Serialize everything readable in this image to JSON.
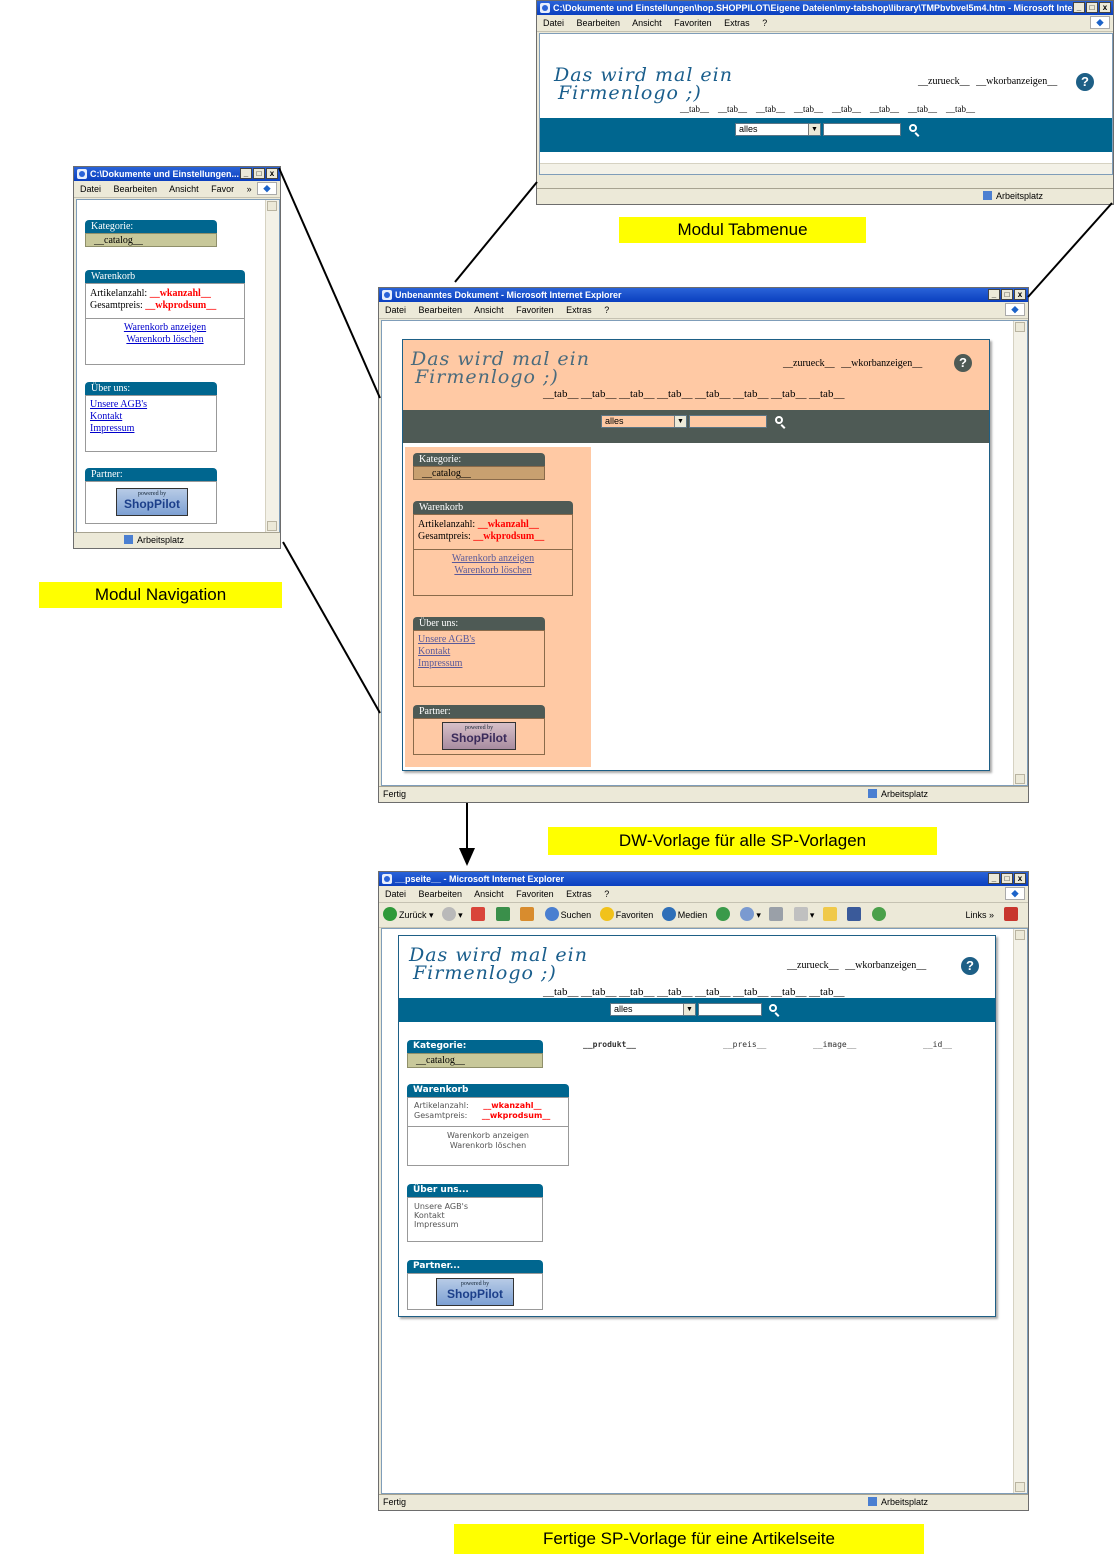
{
  "captions": {
    "tabmenue": "Modul Tabmenue",
    "navigation": "Modul Navigation",
    "dw_vorlage": "DW-Vorlage für alle SP-Vorlagen",
    "fertige": "Fertige SP-Vorlage für eine Artikelseite"
  },
  "menu": {
    "datei": "Datei",
    "bearbeiten": "Bearbeiten",
    "ansicht": "Ansicht",
    "favoriten": "Favoriten",
    "favor_short": "Favor",
    "extras": "Extras",
    "help": "?",
    "more": "»"
  },
  "window_tabmenue": {
    "title": "C:\\Dokumente und Einstellungen\\hop.SHOPPILOT\\Eigene Dateien\\my-tabshop\\library\\TMPbvbvel5m4.htm - Microsoft Inte...",
    "status_right": "Arbeitsplatz"
  },
  "window_navigation": {
    "title": "C:\\Dokumente und Einstellungen...",
    "status_right": "Arbeitsplatz"
  },
  "window_dw": {
    "title": "Unbenanntes Dokument - Microsoft Internet Explorer",
    "status_left": "Fertig",
    "status_right": "Arbeitsplatz"
  },
  "window_final": {
    "title": "__pseite__ - Microsoft Internet Explorer",
    "status_left": "Fertig",
    "status_right": "Arbeitsplatz",
    "toolbar": {
      "back": "Zurück",
      "search": "Suchen",
      "favorites": "Favoriten",
      "media": "Medien",
      "links": "Links"
    }
  },
  "header": {
    "logo_line1": "Das wird mal ein",
    "logo_line2": "Firmenlogo ;)",
    "zurueck": "__zurueck__",
    "wkorbanzeigen": "__wkorbanzeigen__",
    "help_icon": "?",
    "tabs": [
      "__tab__",
      "__tab__",
      "__tab__",
      "__tab__",
      "__tab__",
      "__tab__",
      "__tab__",
      "__tab__"
    ],
    "select_value": "alles",
    "dd_arrow": "▼"
  },
  "nav": {
    "kategorie": "Kategorie:",
    "catalog": "__catalog__",
    "warenkorb": "Warenkorb",
    "artikelanzahl": "Artikelanzahl:",
    "gesamtpreis": "Gesamtpreis:",
    "wkanzahl": "__wkanzahl__",
    "wkprodsum": "__wkprodsum__",
    "warenkorb_anzeigen": "Warenkorb anzeigen",
    "warenkorb_loeschen": "Warenkorb löschen",
    "ueber_uns": "Über uns:",
    "ueber_uns_final": "Über uns...",
    "agb": "Unsere AGB's",
    "kontakt": "Kontakt",
    "impressum": "Impressum",
    "partner": "Partner:",
    "partner_final": "Partner...",
    "powered_by": "powered by",
    "shoppilot": "ShopPilot"
  },
  "product_row": [
    "__produkt__",
    "__preis__",
    "__image__",
    "__id__"
  ],
  "colors": {
    "teal": "#00668f",
    "dark_gray": "#4e5a55",
    "peach": "#ffc9a4",
    "khaki": "#c8c89a",
    "caption": "#ffff00"
  }
}
